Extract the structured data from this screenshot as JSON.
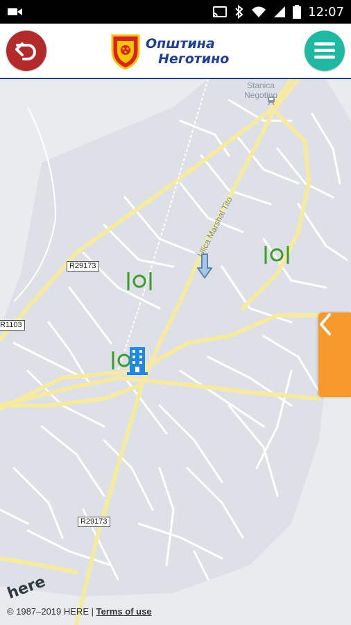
{
  "status_bar": {
    "time": "12:07",
    "icons": [
      "video-icon",
      "cast-icon",
      "bluetooth-icon",
      "wifi-icon",
      "signal-icon",
      "battery-icon"
    ]
  },
  "header": {
    "logo_line1": "Општина",
    "logo_line2": "Неготино",
    "back_icon": "back-arrow-icon",
    "menu_icon": "hamburger-menu-icon",
    "colors": {
      "back": "#b22a2a",
      "menu": "#1fb8a2",
      "title": "#1c3f9b"
    }
  },
  "map": {
    "place_label_1": "Stanica",
    "place_label_2": "Negotino",
    "street_label": "Ulica Marshal Tito",
    "road_labels": [
      "R29173",
      "R1103",
      "R29173"
    ],
    "pois": [
      "restaurant-icon",
      "restaurant-icon",
      "restaurant-icon",
      "hotel-icon",
      "location-pin-icon"
    ],
    "brand": "here",
    "copyright": "© 1987–2019 HERE |",
    "terms": "Terms of use"
  }
}
